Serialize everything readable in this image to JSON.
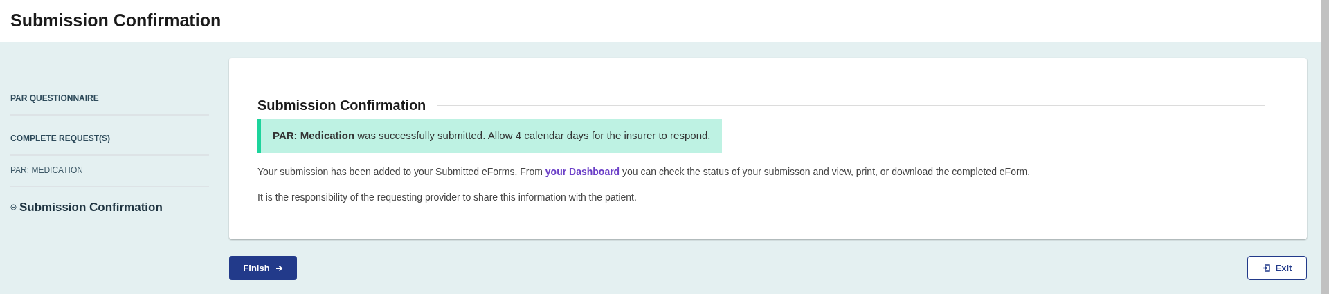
{
  "header": {
    "title": "Submission Confirmation"
  },
  "sidebar": {
    "items": [
      {
        "kind": "heading",
        "label": "PAR QUESTIONNAIRE"
      },
      {
        "kind": "heading",
        "label": "COMPLETE REQUEST(S)"
      },
      {
        "kind": "step",
        "label": "PAR: MEDICATION"
      },
      {
        "kind": "current",
        "label": "Submission Confirmation"
      }
    ]
  },
  "card": {
    "title": "Submission Confirmation",
    "alert": "**PAR: Medication** was successfully submitted. Allow 4 calendar days for the insurer to respond.",
    "paragraphs": [
      {
        "before": "Your submission has been added to your Submitted eForms. From ",
        "link": "your Dashboard",
        "after": " you can check the status of your submisson and view, print, or download the completed eForm."
      },
      {
        "before": "It is the responsibility of the requesting provider to share this information with the patient."
      }
    ]
  },
  "buttons": {
    "finish": "Finish",
    "exit": "Exit"
  }
}
